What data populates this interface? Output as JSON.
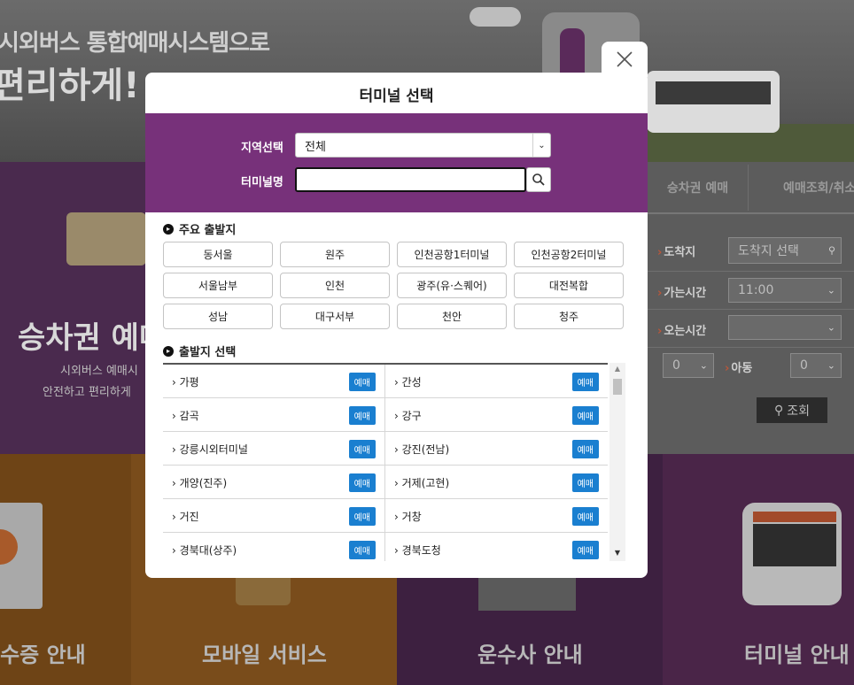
{
  "banner": {
    "line1": "시외버스 통합예매시스템으로",
    "line2": "편리하게!"
  },
  "ticket_panel": {
    "title": "승차권 예매",
    "sub1": "시외버스 예매시",
    "sub2": "안전하고 편리하게"
  },
  "booking_form": {
    "tab_ticket": "승차권 예매",
    "tab_inquiry": "예매조회/취소",
    "arrival_label": "도착지",
    "arrival_placeholder": "도착지 선택",
    "depart_time_label": "가는시간",
    "depart_time_value": "11:00",
    "return_time_label": "오는시간",
    "adult_value": "0",
    "child_label": "아동",
    "child_value": "0",
    "search_label": "조회"
  },
  "bottom_tiles": {
    "tile1": "영수증 안내",
    "tile2": "모바일 서비스",
    "tile3": "운수사 안내",
    "tile4": "터미널 안내"
  },
  "modal": {
    "title": "터미널 선택",
    "region_label": "지역선택",
    "region_value": "전체",
    "terminal_label": "터미널명",
    "terminal_value": "",
    "major_heading": "주요 출발지",
    "major_terminals": [
      "동서울",
      "원주",
      "인천공항1터미널",
      "인천공항2터미널",
      "서울남부",
      "인천",
      "광주(유·스퀘어)",
      "대전복합",
      "성남",
      "대구서부",
      "천안",
      "청주"
    ],
    "depart_heading": "출발지 선택",
    "book_badge": "예매",
    "departure_rows": [
      [
        "› 가평",
        "› 간성"
      ],
      [
        "› 감곡",
        "› 강구"
      ],
      [
        "› 강릉시외터미널",
        "› 강진(전남)"
      ],
      [
        "› 개양(진주)",
        "› 거제(고현)"
      ],
      [
        "› 거진",
        "› 거창"
      ],
      [
        "› 경북대(상주)",
        "› 경북도청"
      ]
    ]
  },
  "colors": {
    "modal_purple": "#77317a",
    "badge_blue": "#1a7fd0"
  }
}
